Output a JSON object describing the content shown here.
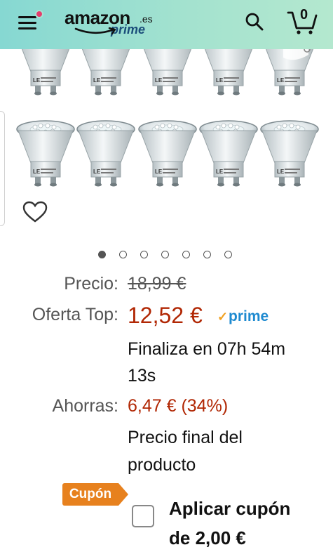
{
  "header": {
    "logo_text": "amazon",
    "logo_tld": ".es",
    "logo_sub": "prime",
    "cart_count": "0",
    "accent": "#86d8d2",
    "notification_color": "#e53d6d"
  },
  "gallery": {
    "image_count": 7,
    "active_index": 0,
    "bulb_marking": "LE"
  },
  "price": {
    "precio_label": "Precio:",
    "precio_value": "18,99 €",
    "oferta_label": "Oferta Top:",
    "oferta_value": "12,52 €",
    "prime_label": "prime",
    "finaliza_line1": "Finaliza en 07h 54m",
    "finaliza_line2": "13s",
    "ahorras_label": "Ahorras:",
    "ahorras_value": "6,47 € (34%)",
    "final_line1": "Precio final del",
    "final_line2": "producto",
    "price_color": "#b12704"
  },
  "coupon": {
    "badge": "Cupón",
    "line1": "Aplicar cupón",
    "line2": "de 2,00 €",
    "badge_color": "#e7811e"
  }
}
